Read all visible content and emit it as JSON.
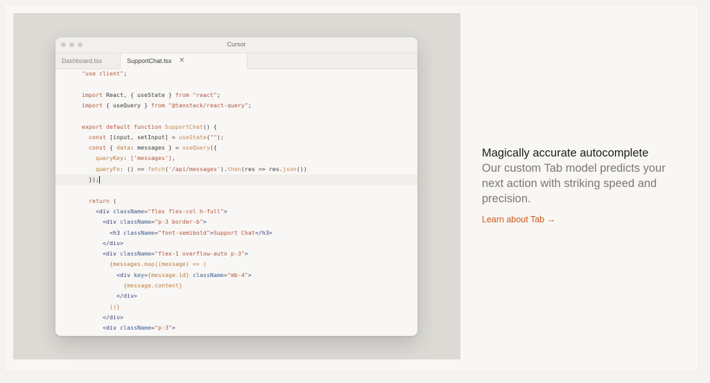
{
  "window": {
    "title": "Cursor"
  },
  "tabs": [
    {
      "label": "Dashboard.tsx"
    },
    {
      "label": "SupportChat.tsx",
      "close": "✕"
    }
  ],
  "code_lines": [
    {
      "indent": 2,
      "tokens": [
        {
          "t": "str",
          "v": "\"use client\""
        },
        {
          "t": "plain",
          "v": ";"
        }
      ]
    },
    {
      "indent": 0,
      "tokens": []
    },
    {
      "indent": 2,
      "tokens": [
        {
          "t": "kw",
          "v": "import"
        },
        {
          "t": "plain",
          "v": " React, { useState } "
        },
        {
          "t": "kw",
          "v": "from"
        },
        {
          "t": "plain",
          "v": " "
        },
        {
          "t": "str",
          "v": "\"react\""
        },
        {
          "t": "plain",
          "v": ";"
        }
      ]
    },
    {
      "indent": 2,
      "tokens": [
        {
          "t": "kw",
          "v": "import"
        },
        {
          "t": "plain",
          "v": " { useQuery } "
        },
        {
          "t": "kw",
          "v": "from"
        },
        {
          "t": "plain",
          "v": " "
        },
        {
          "t": "str",
          "v": "\"@tanstack/react-query\""
        },
        {
          "t": "plain",
          "v": ";"
        }
      ]
    },
    {
      "indent": 0,
      "tokens": []
    },
    {
      "indent": 2,
      "tokens": [
        {
          "t": "kw",
          "v": "export default function"
        },
        {
          "t": "plain",
          "v": " "
        },
        {
          "t": "fn",
          "v": "SupportChat"
        },
        {
          "t": "plain",
          "v": "() {"
        }
      ]
    },
    {
      "indent": 4,
      "tokens": [
        {
          "t": "kw",
          "v": "const"
        },
        {
          "t": "plain",
          "v": " [input, setInput] = "
        },
        {
          "t": "fn",
          "v": "useState"
        },
        {
          "t": "plain",
          "v": "("
        },
        {
          "t": "str",
          "v": "\"\""
        },
        {
          "t": "plain",
          "v": ");"
        }
      ]
    },
    {
      "indent": 4,
      "tokens": [
        {
          "t": "kw",
          "v": "const"
        },
        {
          "t": "plain",
          "v": " { "
        },
        {
          "t": "prop",
          "v": "data"
        },
        {
          "t": "plain",
          "v": ": messages } = "
        },
        {
          "t": "fn",
          "v": "useQuery"
        },
        {
          "t": "plain",
          "v": "({"
        }
      ]
    },
    {
      "indent": 6,
      "tokens": [
        {
          "t": "prop",
          "v": "queryKey"
        },
        {
          "t": "plain",
          "v": ": "
        },
        {
          "t": "str",
          "v": "['messages']"
        },
        {
          "t": "plain",
          "v": ","
        }
      ]
    },
    {
      "indent": 6,
      "tokens": [
        {
          "t": "prop",
          "v": "queryFn"
        },
        {
          "t": "plain",
          "v": ": () => "
        },
        {
          "t": "fn",
          "v": "fetch"
        },
        {
          "t": "plain",
          "v": "("
        },
        {
          "t": "str",
          "v": "'/api/messages'"
        },
        {
          "t": "plain",
          "v": ")."
        },
        {
          "t": "fn",
          "v": "then"
        },
        {
          "t": "plain",
          "v": "(res => res."
        },
        {
          "t": "fn",
          "v": "json"
        },
        {
          "t": "plain",
          "v": "())"
        }
      ]
    },
    {
      "indent": 4,
      "tokens": [
        {
          "t": "plain",
          "v": "});"
        }
      ],
      "cursor": true
    },
    {
      "indent": 0,
      "tokens": []
    },
    {
      "indent": 4,
      "tokens": [
        {
          "t": "kw",
          "v": "return"
        },
        {
          "t": "plain",
          "v": " ("
        }
      ]
    },
    {
      "indent": 6,
      "tokens": [
        {
          "t": "tag",
          "v": "<div"
        },
        {
          "t": "plain",
          "v": " "
        },
        {
          "t": "attr",
          "v": "className"
        },
        {
          "t": "plain",
          "v": "="
        },
        {
          "t": "str",
          "v": "\"flex flex-col h-full\""
        },
        {
          "t": "tag",
          "v": ">"
        }
      ]
    },
    {
      "indent": 8,
      "tokens": [
        {
          "t": "tag",
          "v": "<div"
        },
        {
          "t": "plain",
          "v": " "
        },
        {
          "t": "attr",
          "v": "className"
        },
        {
          "t": "plain",
          "v": "="
        },
        {
          "t": "str",
          "v": "\"p-3 border-b\""
        },
        {
          "t": "tag",
          "v": ">"
        }
      ]
    },
    {
      "indent": 10,
      "tokens": [
        {
          "t": "tag",
          "v": "<h3"
        },
        {
          "t": "plain",
          "v": " "
        },
        {
          "t": "attr",
          "v": "className"
        },
        {
          "t": "plain",
          "v": "="
        },
        {
          "t": "str",
          "v": "\"font-semibold\""
        },
        {
          "t": "tag",
          "v": ">"
        },
        {
          "t": "str",
          "v": "Support Chat"
        },
        {
          "t": "tag",
          "v": "</h3>"
        }
      ]
    },
    {
      "indent": 8,
      "tokens": [
        {
          "t": "tag",
          "v": "</div>"
        }
      ]
    },
    {
      "indent": 8,
      "tokens": [
        {
          "t": "tag",
          "v": "<div"
        },
        {
          "t": "plain",
          "v": " "
        },
        {
          "t": "attr",
          "v": "className"
        },
        {
          "t": "plain",
          "v": "="
        },
        {
          "t": "str",
          "v": "\"flex-1 overflow-auto p-3\""
        },
        {
          "t": "tag",
          "v": ">"
        }
      ]
    },
    {
      "indent": 10,
      "tokens": [
        {
          "t": "prop",
          "v": "{messages."
        },
        {
          "t": "fn",
          "v": "map"
        },
        {
          "t": "prop",
          "v": "((message) => ("
        }
      ]
    },
    {
      "indent": 12,
      "tokens": [
        {
          "t": "tag",
          "v": "<div"
        },
        {
          "t": "plain",
          "v": " "
        },
        {
          "t": "attr",
          "v": "key"
        },
        {
          "t": "plain",
          "v": "="
        },
        {
          "t": "prop",
          "v": "{message.id}"
        },
        {
          "t": "plain",
          "v": " "
        },
        {
          "t": "attr",
          "v": "className"
        },
        {
          "t": "plain",
          "v": "="
        },
        {
          "t": "str",
          "v": "\"mb-4\""
        },
        {
          "t": "tag",
          "v": ">"
        }
      ]
    },
    {
      "indent": 14,
      "tokens": [
        {
          "t": "prop",
          "v": "{message.content}"
        }
      ]
    },
    {
      "indent": 12,
      "tokens": [
        {
          "t": "tag",
          "v": "</div>"
        }
      ]
    },
    {
      "indent": 10,
      "tokens": [
        {
          "t": "prop",
          "v": "))}"
        }
      ]
    },
    {
      "indent": 8,
      "tokens": [
        {
          "t": "tag",
          "v": "</div>"
        }
      ]
    },
    {
      "indent": 8,
      "tokens": [
        {
          "t": "tag",
          "v": "<div"
        },
        {
          "t": "plain",
          "v": " "
        },
        {
          "t": "attr",
          "v": "className"
        },
        {
          "t": "plain",
          "v": "="
        },
        {
          "t": "str",
          "v": "\"p-3\""
        },
        {
          "t": "tag",
          "v": ">"
        }
      ]
    }
  ],
  "feature": {
    "heading": "Magically accurate autocomplete",
    "description": "Our custom Tab model predicts your next action with striking speed and precision.",
    "link": "Learn about Tab →"
  }
}
